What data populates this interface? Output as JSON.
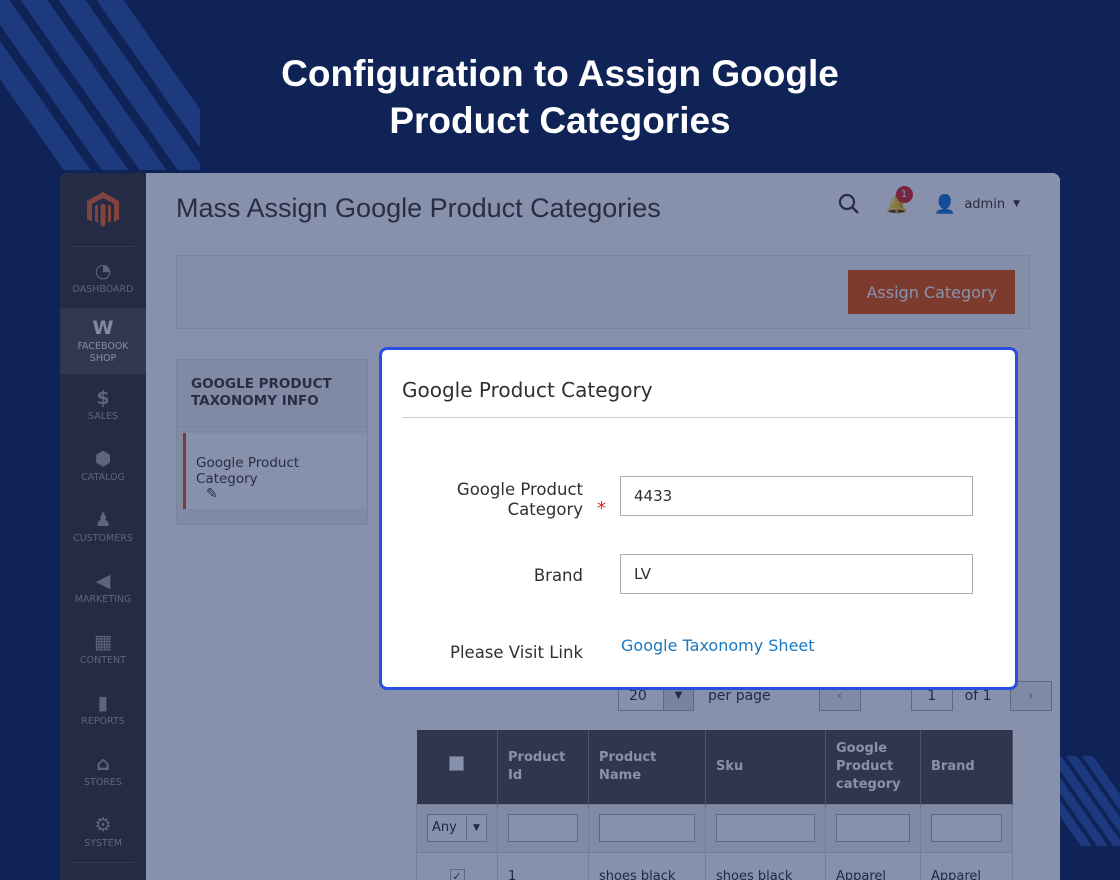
{
  "hero": {
    "line1": "Configuration to Assign Google",
    "line2": "Product Categories"
  },
  "sidebar": {
    "items": [
      {
        "label": "DASHBOARD",
        "icon": "dashboard-icon",
        "glyph": "◔"
      },
      {
        "label": "FACEBOOK SHOP",
        "icon": "facebook-shop-icon",
        "glyph": "W"
      },
      {
        "label": "SALES",
        "icon": "dollar-icon",
        "glyph": "$"
      },
      {
        "label": "CATALOG",
        "icon": "cube-icon",
        "glyph": "⬢"
      },
      {
        "label": "CUSTOMERS",
        "icon": "person-icon",
        "glyph": "♟"
      },
      {
        "label": "MARKETING",
        "icon": "megaphone-icon",
        "glyph": "◀"
      },
      {
        "label": "CONTENT",
        "icon": "layout-icon",
        "glyph": "▦"
      },
      {
        "label": "REPORTS",
        "icon": "bar-chart-icon",
        "glyph": "▮"
      },
      {
        "label": "STORES",
        "icon": "store-icon",
        "glyph": "⌂"
      },
      {
        "label": "SYSTEM",
        "icon": "gear-icon",
        "glyph": "⚙"
      }
    ]
  },
  "header": {
    "page_title": "Mass Assign Google Product Categories",
    "notification_count": "1",
    "user": "admin"
  },
  "actions": {
    "assign_label": "Assign Category"
  },
  "tabs": {
    "heading": "GOOGLE PRODUCT TAXONOMY INFO",
    "item": "Google Product Category"
  },
  "grid": {
    "per_page_value": "20",
    "per_page_label": "per page",
    "page": "1",
    "of_label": "of 1",
    "columns": [
      "Product Id",
      "Product Name",
      "Sku",
      "Google Product category",
      "Brand"
    ],
    "filter_any": "Any",
    "rows": [
      {
        "id": "1",
        "name": "shoes black",
        "sku": "shoes black",
        "category": "Apparel",
        "brand": "Apparel"
      }
    ]
  },
  "modal": {
    "title": "Google Product Category",
    "category_label": "Google Product Category",
    "category_value": "4433",
    "brand_label": "Brand",
    "brand_value": "LV",
    "visit_label": "Please Visit Link",
    "link_text": "Google Taxonomy Sheet"
  },
  "colors": {
    "background": "#0f2356",
    "accent": "#eb5202",
    "modal_border": "#2a4fe0",
    "link": "#1979c3"
  }
}
